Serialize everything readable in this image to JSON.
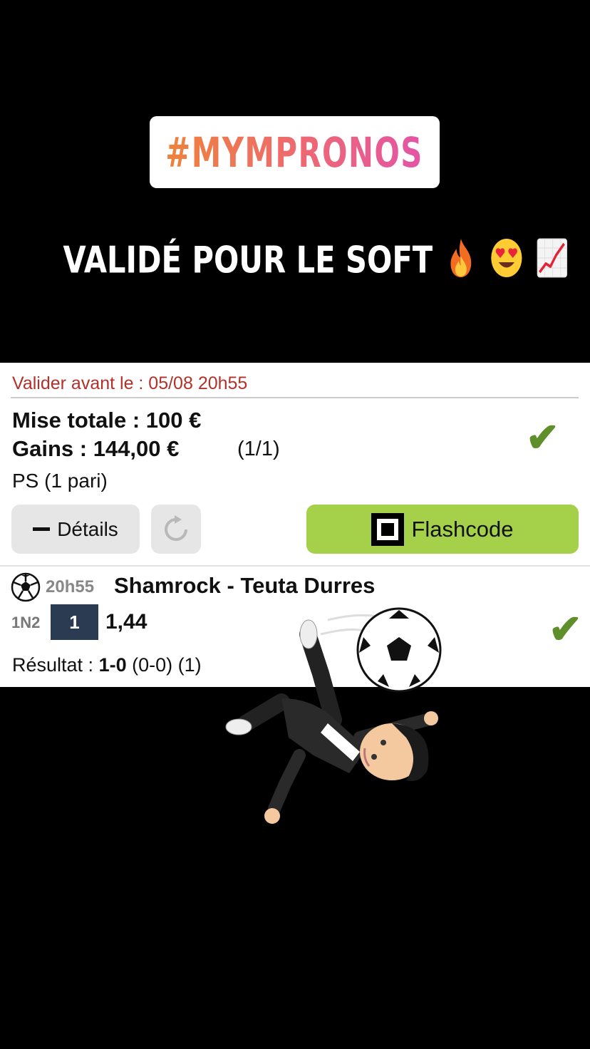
{
  "story": {
    "hashtag": "#MYMPRONOS",
    "headline": "VALIDÉ POUR LE SOFT",
    "headline_emojis": [
      "fire",
      "heart-eyes",
      "chart-increasing"
    ]
  },
  "ticket": {
    "deadline": "Valider avant le : 05/08 20h55",
    "stake": "Mise totale : 100 €",
    "gains": "Gains : 144,00 €",
    "ratio": "(1/1)",
    "bet_type": "PS (1 pari)",
    "status": "won",
    "details_label": "Détails",
    "flashcode_label": "Flashcode"
  },
  "selection": {
    "time": "20h55",
    "match": "Shamrock - Teuta Durres",
    "market": "1N2",
    "pick": "1",
    "odds": "1,44",
    "result_label": "Résultat :",
    "result_score": "1-0",
    "result_extra": "(0-0) (1)",
    "status": "won"
  },
  "colors": {
    "deadline": "#b3312b",
    "flashcode_bg": "#a5d04a",
    "check": "#5f8f2a",
    "pick_bg": "#2b3b52"
  }
}
